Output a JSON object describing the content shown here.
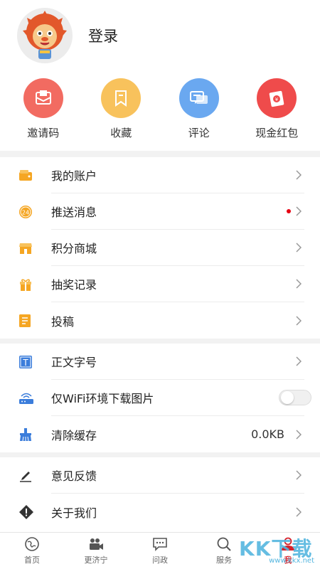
{
  "profile": {
    "login_label": "登录"
  },
  "quick_actions": [
    {
      "label": "邀请码",
      "icon": "envelope-icon",
      "color": "#f26b61"
    },
    {
      "label": "收藏",
      "icon": "bookmark-icon",
      "color": "#f8c25c"
    },
    {
      "label": "评论",
      "icon": "chat-icon",
      "color": "#6aa8f0"
    },
    {
      "label": "现金红包",
      "icon": "red-packet-icon",
      "color": "#ef4b4b"
    }
  ],
  "menu_group_1": [
    {
      "label": "我的账户",
      "icon": "wallet-icon"
    },
    {
      "label": "推送消息",
      "icon": "push-24-icon",
      "has_dot": true
    },
    {
      "label": "积分商城",
      "icon": "shop-icon"
    },
    {
      "label": "抽奖记录",
      "icon": "gift-icon"
    },
    {
      "label": "投稿",
      "icon": "notebook-icon"
    }
  ],
  "menu_group_2": [
    {
      "label": "正文字号",
      "icon": "font-size-icon"
    },
    {
      "label": "仅WiFi环境下载图片",
      "icon": "wifi-router-icon",
      "toggle_on": false
    },
    {
      "label": "清除缓存",
      "icon": "broom-icon",
      "value": "0.0KB"
    }
  ],
  "menu_group_3": [
    {
      "label": "意见反馈",
      "icon": "pencil-icon"
    },
    {
      "label": "关于我们",
      "icon": "info-diamond-icon"
    }
  ],
  "tabbar": [
    {
      "label": "首页",
      "icon": "globe-icon"
    },
    {
      "label": "更济宁",
      "icon": "video-camera-icon"
    },
    {
      "label": "问政",
      "icon": "message-icon"
    },
    {
      "label": "服务",
      "icon": "search-icon"
    },
    {
      "label": "我",
      "icon": "person-icon",
      "active": true
    }
  ],
  "watermark": {
    "text": "KK下载",
    "url": "www.kkx.net"
  },
  "colors": {
    "accent": "#d7212a",
    "icon_orange": "#f5a623"
  }
}
